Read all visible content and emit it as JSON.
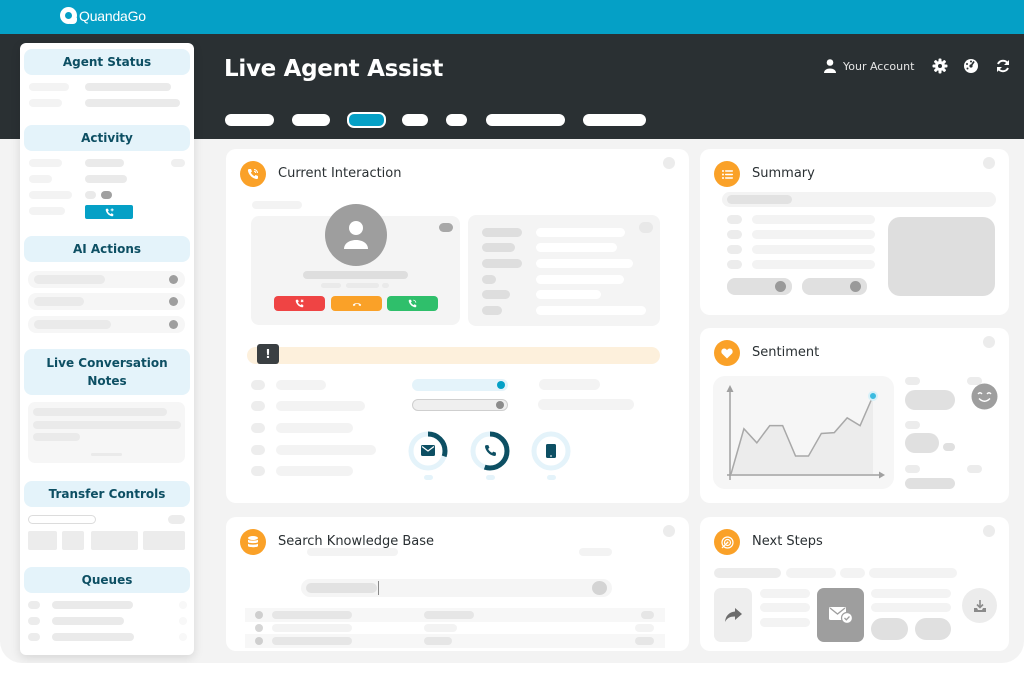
{
  "app": {
    "brand": "QuandaGo",
    "title": "Live Agent Assist",
    "account_label": "Your Account",
    "icons": [
      "user-icon",
      "gear-icon",
      "dashboard-gauge-icon",
      "refresh-icon"
    ]
  },
  "tabs": [
    {
      "label": "",
      "active": false
    },
    {
      "label": "",
      "active": false
    },
    {
      "label": "",
      "active": true
    },
    {
      "label": "",
      "active": false
    },
    {
      "label": "",
      "active": false
    },
    {
      "label": "",
      "active": false
    },
    {
      "label": "",
      "active": false
    }
  ],
  "sidebar": {
    "sections": [
      {
        "title": "Agent Status"
      },
      {
        "title": "Activity"
      },
      {
        "title": "AI Actions"
      },
      {
        "title": "Live Conversation Notes"
      },
      {
        "title": "Transfer Controls"
      },
      {
        "title": "Queues"
      }
    ]
  },
  "cards": {
    "current_interaction": {
      "title": "Current Interaction",
      "icon": "phone-signal-icon"
    },
    "summary": {
      "title": "Summary",
      "icon": "list-icon"
    },
    "sentiment": {
      "title": "Sentiment",
      "icon": "heart-icon"
    },
    "search_kb": {
      "title": "Search Knowledge Base",
      "icon": "database-icon"
    },
    "next_steps": {
      "title": "Next Steps",
      "icon": "target-icon"
    }
  },
  "colors": {
    "brand": "#05a0c6",
    "header": "#2a3033",
    "accent_orange": "#faa128",
    "sidebar_heading_bg": "#e4f3fa",
    "sidebar_heading_text": "#0d4f63",
    "decline_red": "#ef4444",
    "hold_orange": "#faa128",
    "accept_green": "#2fbf6b",
    "channel_dark": "#0d4f63"
  },
  "channels": [
    {
      "name": "email",
      "progress": 0.3
    },
    {
      "name": "phone",
      "progress": 0.55
    },
    {
      "name": "tablet",
      "progress": 0.0
    }
  ],
  "chart_data": {
    "type": "area",
    "title": "",
    "xlabel": "",
    "ylabel": "",
    "x": [
      0,
      1,
      2,
      3,
      4,
      5,
      6,
      7,
      8,
      9,
      10,
      11,
      12
    ],
    "values": [
      0,
      58,
      40,
      62,
      62,
      23,
      23,
      52,
      53,
      72,
      62,
      100,
      100
    ],
    "ylim": [
      0,
      110
    ],
    "grid": false,
    "legend": "none",
    "highlight_last_point": true
  }
}
